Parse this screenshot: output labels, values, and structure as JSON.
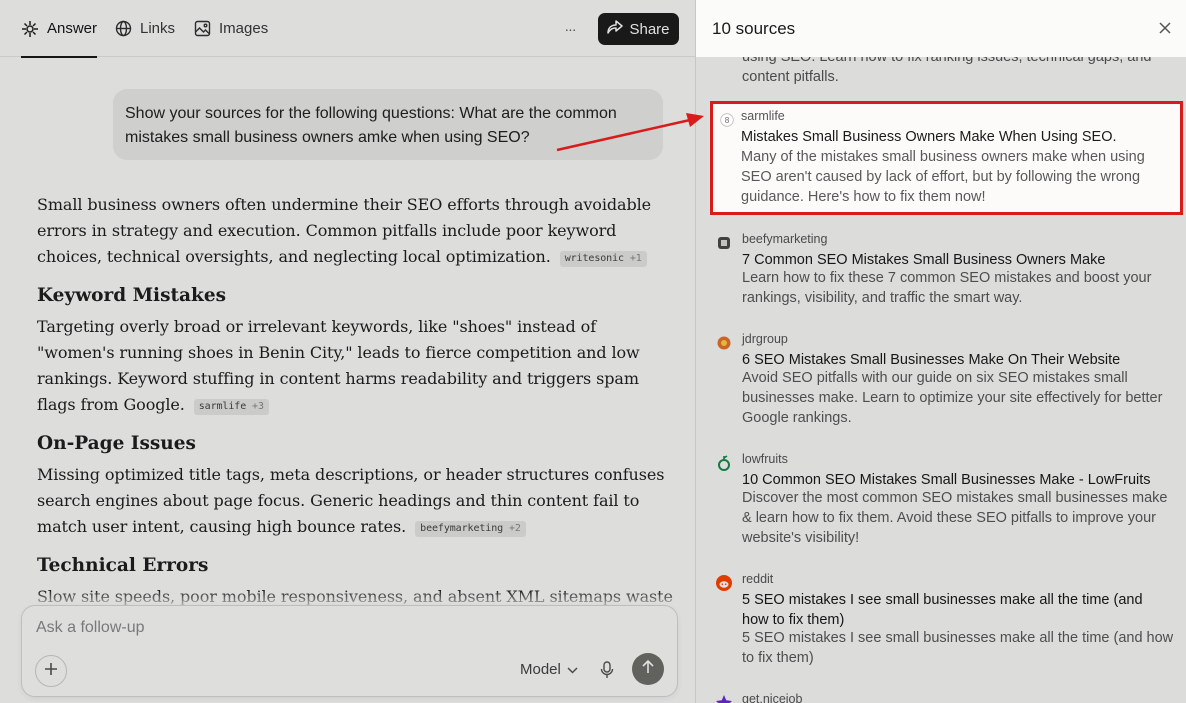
{
  "tabs": [
    {
      "label": "Answer",
      "icon": "answer-icon",
      "active": true
    },
    {
      "label": "Links",
      "icon": "globe-icon"
    },
    {
      "label": "Images",
      "icon": "image-icon"
    }
  ],
  "toolbar": {
    "more_label": "···",
    "share_label": "Share"
  },
  "question": "Show your sources for the following questions: What are the common mistakes small business owners amke when using SEO?",
  "answer": {
    "intro": "Small business owners often undermine their SEO efforts through avoidable errors in strategy and execution. Common pitfalls include poor keyword choices, technical oversights, and neglecting local optimization.",
    "intro_cite": {
      "source": "writesonic",
      "count": "+1"
    },
    "sections": [
      {
        "heading": "Keyword Mistakes",
        "text": "Targeting overly broad or irrelevant keywords, like \"shoes\" instead of \"women's running shoes in Benin City,\" leads to fierce competition and low rankings. Keyword stuffing in content harms readability and triggers spam flags from Google.",
        "cite": {
          "source": "sarmlife",
          "count": "+3"
        }
      },
      {
        "heading": "On-Page Issues",
        "text": "Missing optimized title tags, meta descriptions, or header structures confuses search engines about page focus. Generic headings and thin content fail to match user intent, causing high bounce rates.",
        "cite": {
          "source": "beefymarketing",
          "count": "+2"
        }
      },
      {
        "heading": "Technical Errors",
        "text": "Slow site speeds, poor mobile responsiveness, and absent XML sitemaps waste"
      }
    ]
  },
  "followup": {
    "placeholder": "Ask a follow-up",
    "model_label": "Model"
  },
  "sources_panel": {
    "title": "10 sources",
    "cutoff_text": "using SEO. Learn how to fix ranking issues, technical gaps, and content pitfalls.",
    "items": [
      {
        "domain": "sarmlife",
        "title": "Mistakes Small Business Owners Make When Using SEO.",
        "description": "Many of the mistakes small business owners make when using SEO aren't caused by lack of effort, but by following the wrong guidance. Here's how to fix them now!",
        "icon": "sarmlife-favicon",
        "highlighted": true
      },
      {
        "domain": "beefymarketing",
        "title": "7 Common SEO Mistakes Small Business Owners Make",
        "description": "Learn how to fix these 7 common SEO mistakes and boost your rankings, visibility, and traffic the smart way.",
        "icon": "beefymarketing-favicon"
      },
      {
        "domain": "jdrgroup",
        "title": "6 SEO Mistakes Small Businesses Make On Their Website",
        "description": "Avoid SEO pitfalls with our guide on six SEO mistakes small businesses make. Learn to optimize your site effectively for better Google rankings.",
        "icon": "jdrgroup-favicon"
      },
      {
        "domain": "lowfruits",
        "title": "10 Common SEO Mistakes Small Businesses Make - LowFruits",
        "description": "Discover the most common SEO mistakes small businesses make & learn how to fix them. Avoid these SEO pitfalls to improve your website's visibility!",
        "icon": "lowfruits-favicon"
      },
      {
        "domain": "reddit",
        "title": "5 SEO mistakes I see small businesses make all the time (and how to fix them)",
        "description": "5 SEO mistakes I see small businesses make all the time (and how to fix them)",
        "icon": "reddit-favicon"
      },
      {
        "domain": "get.nicejob",
        "icon": "nicejob-favicon"
      }
    ]
  },
  "colors": {
    "accent_dark": "#1d1d1d",
    "highlight": "#d91b1b",
    "reddit": "#ff4500"
  }
}
